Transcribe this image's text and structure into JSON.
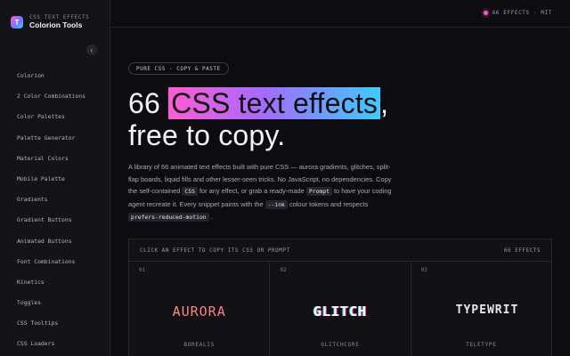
{
  "brand": {
    "kicker": "CSS TEXT EFFECTS",
    "name": "Colorion Tools",
    "logo_letter": "T",
    "collapse_icon": "‹"
  },
  "sidebar": {
    "items": [
      {
        "label": "Colorion"
      },
      {
        "label": "2 Color Combinations"
      },
      {
        "label": "Color Palettes"
      },
      {
        "label": "Palette Generator"
      },
      {
        "label": "Material Colors"
      },
      {
        "label": "Mobile Palette"
      },
      {
        "label": "Gradients"
      },
      {
        "label": "Gradient Buttons"
      },
      {
        "label": "Animated Buttons"
      },
      {
        "label": "Font Combinations"
      },
      {
        "label": "Kinetics"
      },
      {
        "label": "Toggles"
      },
      {
        "label": "CSS Tooltips"
      },
      {
        "label": "CSS Loaders"
      }
    ]
  },
  "topbar": {
    "status": "66 EFFECTS · MIT",
    "accent": "#ff4fd0"
  },
  "hero": {
    "pill": "PURE CSS · COPY & PASTE",
    "title_pre": "66 ",
    "title_highlight": "CSS text effects",
    "title_post": ",",
    "title_line2": "free to copy."
  },
  "description": {
    "p1": "A library of 66 animated text effects built with pure CSS — aurora gradients, glitches, split-flap boards, liquid fills and other lesser-seen tricks. No JavaScript, no dependencies. Copy the self-contained ",
    "code1": "CSS",
    "p2": " for any effect, or grab a ready-made ",
    "code2": "Prompt",
    "p3": " to have your coding agent recreate it. Every snippet paints with the ",
    "code3": "--ink",
    "p4": " colour tokens and respects ",
    "code4": "prefers-reduced-motion",
    "p5": " ."
  },
  "panel": {
    "heading": "CLICK AN EFFECT TO COPY ITS CSS OR PROMPT",
    "count": "66 EFFECTS",
    "cards": [
      {
        "num": "01",
        "demo": "AURORA",
        "label": "BOREALIS"
      },
      {
        "num": "02",
        "demo": "GLITCH",
        "label": "GLITCHCORE"
      },
      {
        "num": "03",
        "demo": "TYPEWRIT",
        "label": "TELETYPE"
      }
    ]
  }
}
